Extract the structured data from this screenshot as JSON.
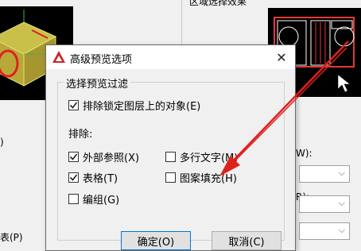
{
  "background": {
    "right_title": "区域选择效果",
    "left_partial_text_1": ")",
    "left_partial_text_2": "表(P)",
    "right_partial_text_1": "W):",
    "right_partial_text_2": "R):"
  },
  "dialog": {
    "title": "高级预览选项",
    "close_symbol": "✕",
    "group_label": "选择预览过滤",
    "lock_filter_label": "排除锁定图层上的对象(E)",
    "lock_filter_checked": true,
    "exclude_label": "排除:",
    "options": {
      "xref": {
        "label": "外部参照(X)",
        "checked": true
      },
      "table": {
        "label": "表格(T)",
        "checked": true
      },
      "group": {
        "label": "编组(G)",
        "checked": false
      },
      "mtext": {
        "label": "多行文字(M)",
        "checked": false
      },
      "hatch": {
        "label": "图案填充(H)",
        "checked": false
      }
    },
    "ok_label": "确定(O)",
    "cancel_label": "取消(C)"
  },
  "colors": {
    "accent": "#0078d7",
    "annotation_arrow": "#e0201c",
    "app_icon": "#c62828"
  }
}
